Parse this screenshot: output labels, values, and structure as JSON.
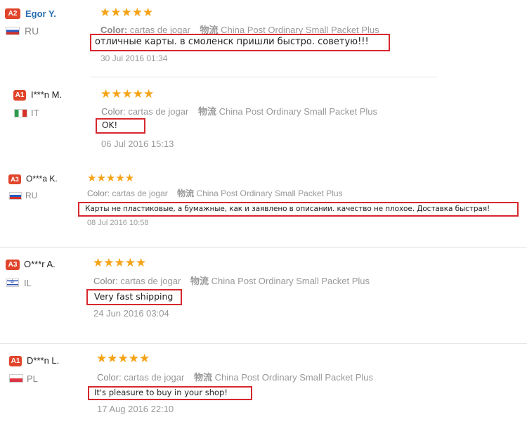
{
  "labels": {
    "color": "Color:",
    "shipping": "物流"
  },
  "reviews": [
    {
      "badge": "A2",
      "name": "Egor Y.",
      "country": "RU",
      "stars": "★★★★★",
      "color": "cartas de jogar",
      "shipping": "China Post Ordinary Small Packet Plus",
      "comment": "отличные карты. в смоленск пришли быстро. советую!!!",
      "date": "30 Jul 2016 01:34"
    },
    {
      "badge": "A1",
      "name": "I***n M.",
      "country": "IT",
      "stars": "★★★★★",
      "color": "cartas de jogar",
      "shipping": "China Post Ordinary Small Packet Plus",
      "comment": "OK!",
      "date": "06 Jul 2016 15:13"
    },
    {
      "badge": "A3",
      "name": "O***a K.",
      "country": "RU",
      "stars": "★★★★★",
      "color": "cartas de jogar",
      "shipping": "China Post Ordinary Small Packet Plus",
      "comment": "Карты не пластиковые, а бумажные, как и заявлено в описании. качество не плохое. Доставка быстрая!",
      "date": "08 Jul 2016 10:58"
    },
    {
      "badge": "A3",
      "name": "O***r A.",
      "country": "IL",
      "stars": "★★★★★",
      "color": "cartas de jogar",
      "shipping": "China Post Ordinary Small Packet Plus",
      "comment": "Very fast shipping",
      "date": "24 Jun 2016 03:04"
    },
    {
      "badge": "A1",
      "name": "D***n L.",
      "country": "PL",
      "stars": "★★★★★",
      "color": "cartas de jogar",
      "shipping": "China Post Ordinary Small Packet Plus",
      "comment": "It's pleasure to buy in your shop!",
      "date": "17 Aug 2016 22:10"
    }
  ],
  "colors": {
    "badge": "#e0452b",
    "star": "#f5a316",
    "highlight": "#d6282e",
    "name_link": "#2a6fb0"
  }
}
